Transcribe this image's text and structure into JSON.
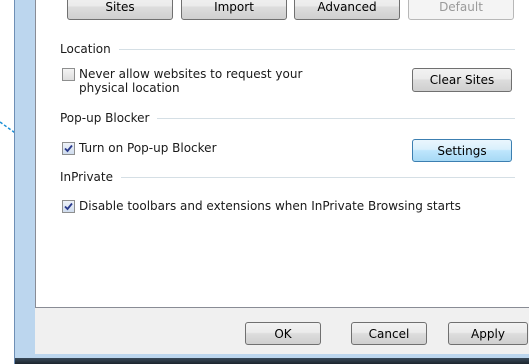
{
  "top_buttons": {
    "sites": "Sites",
    "import": "Import",
    "advanced": "Advanced",
    "default": "Default"
  },
  "location": {
    "header": "Location",
    "never_allow_line1": "Never allow websites to request your",
    "never_allow_line2": "physical location",
    "never_allow_checked": false,
    "clear_sites": "Clear Sites"
  },
  "popup": {
    "header": "Pop-up Blocker",
    "turn_on": "Turn on Pop-up Blocker",
    "turn_on_checked": true,
    "settings": "Settings"
  },
  "inprivate": {
    "header": "InPrivate",
    "disable_toolbars": "Disable toolbars and extensions when InPrivate Browsing starts",
    "disable_toolbars_checked": true
  },
  "footer": {
    "ok": "OK",
    "cancel": "Cancel",
    "apply": "Apply"
  },
  "colors": {
    "callout": "#1a8fd6",
    "frame": "#bcd6ee",
    "focus_border": "#3c7fb1"
  }
}
